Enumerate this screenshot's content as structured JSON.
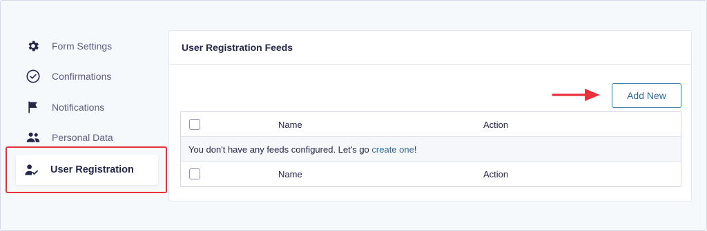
{
  "sidebar": {
    "items": [
      {
        "label": "Form Settings",
        "icon": "gear-icon"
      },
      {
        "label": "Confirmations",
        "icon": "check-circle-icon"
      },
      {
        "label": "Notifications",
        "icon": "flag-icon"
      },
      {
        "label": "Personal Data",
        "icon": "users-icon"
      },
      {
        "label": "User Registration",
        "icon": "user-check-icon",
        "active": true
      }
    ]
  },
  "panel": {
    "title": "User Registration Feeds",
    "add_new_label": "Add New",
    "table": {
      "columns": [
        "Name",
        "Action"
      ],
      "empty_message": "You don't have any feeds configured. Let's go ",
      "empty_link": "create one",
      "empty_suffix": "!"
    }
  },
  "colors": {
    "highlight": "#e8303b",
    "link": "#2f6a97",
    "text": "#242748"
  }
}
